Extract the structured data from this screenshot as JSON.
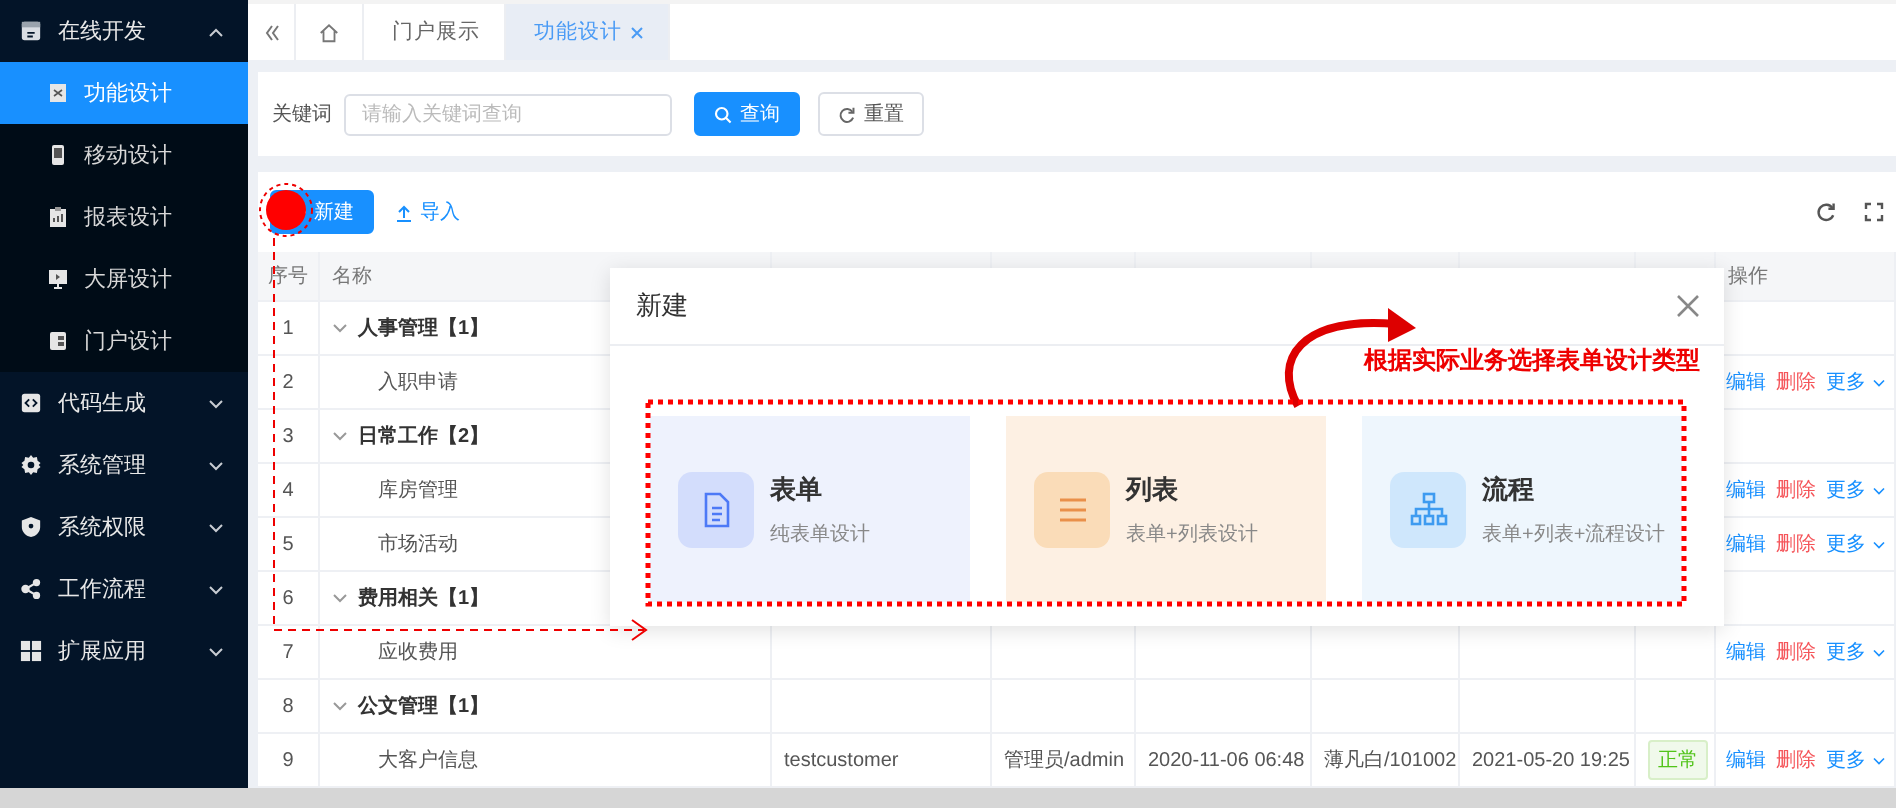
{
  "sidebar": {
    "groups": [
      {
        "label": "在线开发",
        "expanded": true,
        "children": [
          {
            "label": "功能设计",
            "selected": true
          },
          {
            "label": "移动设计",
            "selected": false
          },
          {
            "label": "报表设计",
            "selected": false
          },
          {
            "label": "大屏设计",
            "selected": false
          },
          {
            "label": "门户设计",
            "selected": false
          }
        ]
      },
      {
        "label": "代码生成",
        "expanded": false
      },
      {
        "label": "系统管理",
        "expanded": false
      },
      {
        "label": "系统权限",
        "expanded": false
      },
      {
        "label": "工作流程",
        "expanded": false
      },
      {
        "label": "扩展应用",
        "expanded": false
      }
    ]
  },
  "tabs": [
    {
      "label": "门户展示",
      "selected": false,
      "closable": false
    },
    {
      "label": "功能设计",
      "selected": true,
      "closable": true
    }
  ],
  "search": {
    "label": "关键词",
    "placeholder": "请输入关键词查询",
    "buttons": [
      {
        "label": "查询",
        "kind": "primary"
      },
      {
        "label": "重置",
        "kind": "default"
      }
    ]
  },
  "toolbar": {
    "buttons": [
      {
        "label": "新建",
        "kind": "primary"
      },
      {
        "label": "导入",
        "kind": "link"
      }
    ]
  },
  "table": {
    "columns": [
      "序号",
      "名称",
      "操作"
    ],
    "rows": [
      {
        "index": "1",
        "name": "人事管理【1】",
        "kind": "group",
        "expanded": true
      },
      {
        "index": "2",
        "name": "入职申请",
        "kind": "item",
        "actions": [
          {
            "label": "编辑",
            "kind": "edit"
          },
          {
            "label": "删除",
            "kind": "delete"
          },
          {
            "label": "更多",
            "kind": "more"
          }
        ]
      },
      {
        "index": "3",
        "name": "日常工作【2】",
        "kind": "group",
        "expanded": true
      },
      {
        "index": "4",
        "name": "库房管理",
        "kind": "item",
        "actions": [
          {
            "label": "编辑",
            "kind": "edit"
          },
          {
            "label": "删除",
            "kind": "delete"
          },
          {
            "label": "更多",
            "kind": "more"
          }
        ]
      },
      {
        "index": "5",
        "name": "市场活动",
        "kind": "item",
        "actions": [
          {
            "label": "编辑",
            "kind": "edit"
          },
          {
            "label": "删除",
            "kind": "delete"
          },
          {
            "label": "更多",
            "kind": "more"
          }
        ]
      },
      {
        "index": "6",
        "name": "费用相关【1】",
        "kind": "group",
        "expanded": true
      },
      {
        "index": "7",
        "name": "应收费用",
        "kind": "item",
        "actions": [
          {
            "label": "编辑",
            "kind": "edit"
          },
          {
            "label": "删除",
            "kind": "delete"
          },
          {
            "label": "更多",
            "kind": "more"
          }
        ]
      },
      {
        "index": "8",
        "name": "公文管理【1】",
        "kind": "group",
        "expanded": true
      },
      {
        "index": "9",
        "name": "大客户信息",
        "kind": "item",
        "cells": [
          "testcustomer",
          "管理员/admin",
          "2020-11-06 06:48",
          "薄凡白/101002",
          "2021-05-20 19:25"
        ],
        "status": "正常",
        "actions": [
          {
            "label": "编辑",
            "kind": "edit"
          },
          {
            "label": "删除",
            "kind": "delete"
          },
          {
            "label": "更多",
            "kind": "more"
          }
        ]
      }
    ]
  },
  "dialog": {
    "title": "新建",
    "options": [
      {
        "kind": "form",
        "title": "表单",
        "subtitle": "纯表单设计"
      },
      {
        "kind": "list",
        "title": "列表",
        "subtitle": "表单+列表设计"
      },
      {
        "kind": "flow",
        "title": "流程",
        "subtitle": "表单+列表+流程设计"
      }
    ]
  },
  "annotation": {
    "hint": "根据实际业务选择表单设计类型"
  }
}
